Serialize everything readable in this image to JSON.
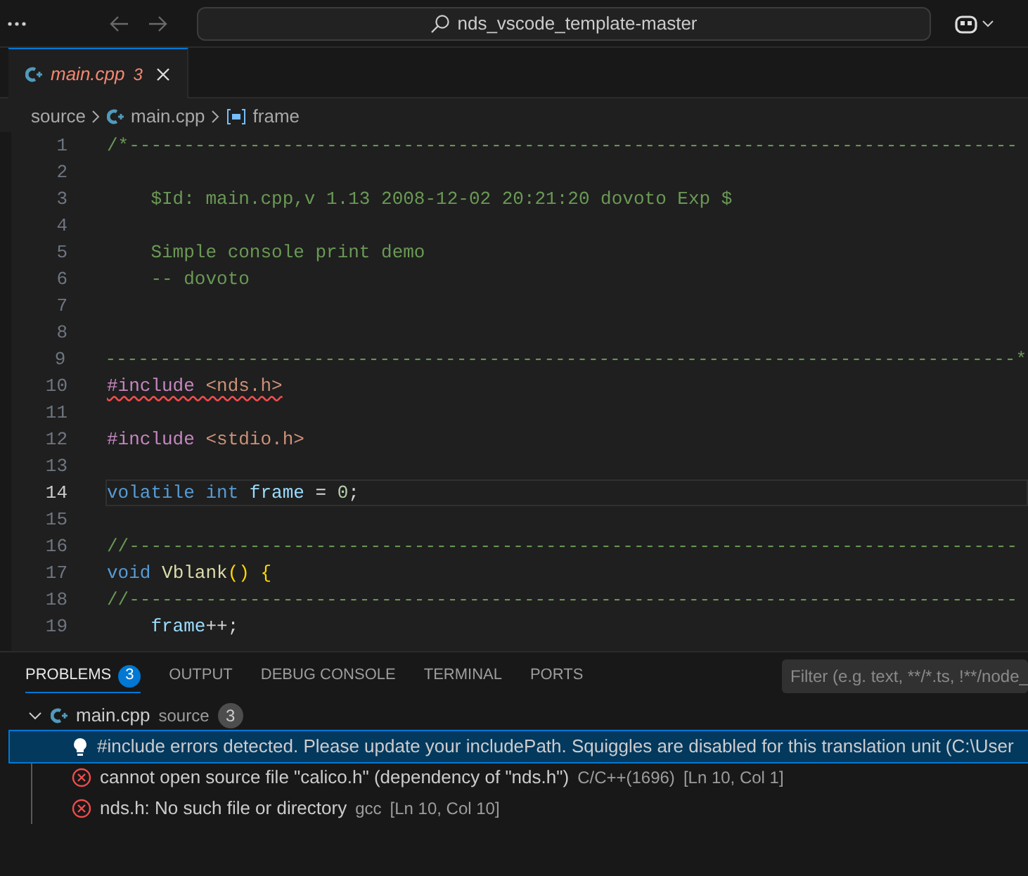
{
  "title_bar": {
    "search_text": "nds_vscode_template-master"
  },
  "tabs": [
    {
      "label": "main.cpp",
      "problem_count": "3",
      "selected": true
    }
  ],
  "breadcrumbs": [
    {
      "label": "source",
      "kind": "folder"
    },
    {
      "label": "main.cpp",
      "kind": "file"
    },
    {
      "label": "frame",
      "kind": "symbol"
    }
  ],
  "editor": {
    "lines": [
      {
        "number": "1",
        "current": false,
        "tokens": [
          {
            "text": "/*---------------------------------------------------------------------------------",
            "kind": "comment"
          }
        ]
      },
      {
        "number": "2",
        "current": false
      },
      {
        "number": "3",
        "current": false,
        "tokens": [
          {
            "text": "    $Id: main.cpp,v 1.13 2008-12-02 20:21:20 dovoto Exp $",
            "kind": "comment"
          }
        ]
      },
      {
        "number": "4",
        "current": false
      },
      {
        "number": "5",
        "current": false,
        "tokens": [
          {
            "text": "    Simple console print demo",
            "kind": "comment"
          }
        ]
      },
      {
        "number": "6",
        "current": false,
        "tokens": [
          {
            "text": "    -- dovoto",
            "kind": "comment"
          }
        ]
      },
      {
        "number": "7",
        "current": false
      },
      {
        "number": "8",
        "current": false
      },
      {
        "number": "9",
        "current": false,
        "tokens": [
          {
            "text": "-----------------------------------------------------------------------------------*",
            "kind": "comment"
          }
        ]
      },
      {
        "number": "10",
        "current": false,
        "tokens": [
          {
            "text": "#include ",
            "kind": "directive",
            "squiggle": true
          },
          {
            "text": "<nds.h>",
            "kind": "string",
            "squiggle": true
          }
        ]
      },
      {
        "number": "11",
        "current": false
      },
      {
        "number": "12",
        "current": false,
        "tokens": [
          {
            "text": "#include ",
            "kind": "directive",
            "squiggle": false
          },
          {
            "text": "<stdio.h>",
            "kind": "string",
            "squiggle": false
          }
        ]
      },
      {
        "number": "13",
        "current": false
      },
      {
        "number": "14",
        "current": true,
        "tokens": [
          {
            "text": "volatile int ",
            "kind": "keyword"
          },
          {
            "text": "frame",
            "kind": "variable"
          },
          {
            "text": " = ",
            "kind": "plain"
          },
          {
            "text": "0",
            "kind": "number"
          },
          {
            "text": ";",
            "kind": "plain"
          }
        ]
      },
      {
        "number": "15",
        "current": false
      },
      {
        "number": "16",
        "current": false,
        "tokens": [
          {
            "text": "//---------------------------------------------------------------------------------",
            "kind": "comment"
          }
        ]
      },
      {
        "number": "17",
        "current": false,
        "tokens": [
          {
            "text": "void ",
            "kind": "keyword"
          },
          {
            "text": "Vblank",
            "kind": "function"
          },
          {
            "text": "() {",
            "kind": "bracket"
          }
        ]
      },
      {
        "number": "18",
        "current": false,
        "tokens": [
          {
            "text": "//---------------------------------------------------------------------------------",
            "kind": "comment"
          }
        ]
      },
      {
        "number": "19",
        "current": false,
        "tokens": [
          {
            "text": "    frame",
            "kind": "variable"
          },
          {
            "text": "++;",
            "kind": "plain"
          }
        ]
      }
    ]
  },
  "panel": {
    "tabs": [
      {
        "label": "PROBLEMS",
        "badge": "3",
        "selected": true
      },
      {
        "label": "OUTPUT",
        "selected": false
      },
      {
        "label": "DEBUG CONSOLE",
        "selected": false
      },
      {
        "label": "TERMINAL",
        "selected": false
      },
      {
        "label": "PORTS",
        "selected": false
      }
    ],
    "filter": {
      "placeholder": "Filter (e.g. text, **/*.ts, !**/node_"
    },
    "file_group": {
      "file": "main.cpp",
      "folder": "source",
      "count": "3",
      "expanded": true,
      "problems": [
        {
          "kind": "info",
          "message": "#include errors detected. Please update your includePath. Squiggles are disabled for this translation unit (C:\\User",
          "selected": true
        },
        {
          "kind": "error",
          "message": "cannot open source file \"calico.h\" (dependency of \"nds.h\")",
          "source": "C/C++(1696)",
          "location": "[Ln 10, Col 1]",
          "selected": false
        },
        {
          "kind": "error",
          "message": "nds.h: No such file or directory",
          "source": "gcc",
          "location": "[Ln 10, Col 10]",
          "selected": false
        }
      ]
    }
  }
}
